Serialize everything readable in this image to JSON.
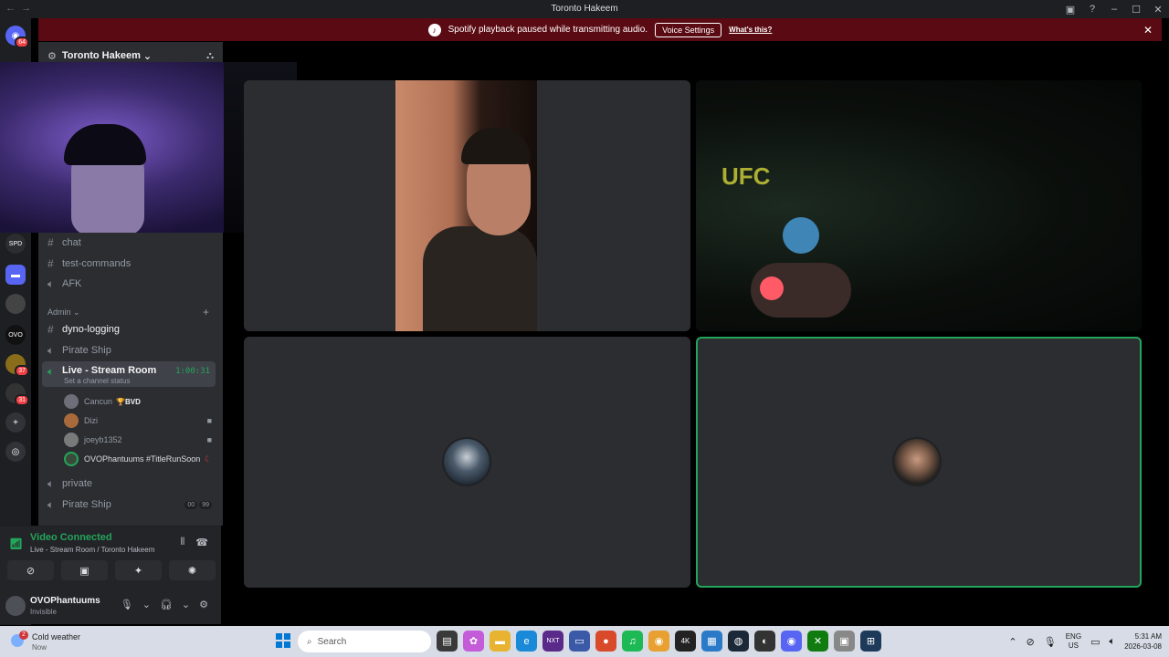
{
  "window": {
    "title": "Toronto Hakeem",
    "nav_back": "←",
    "nav_forward": "→",
    "controls": [
      "▣",
      "?",
      "–",
      "☐",
      "✕"
    ]
  },
  "banner": {
    "message": "Spotify playback paused while transmitting audio.",
    "button": "Voice Settings",
    "link": "What's this?",
    "close": "✕"
  },
  "server": {
    "name": "Toronto Hakeem",
    "rail": [
      {
        "icon": "discord-home-icon",
        "badge": "64"
      },
      {
        "icon": "server-icon",
        "badge": "37"
      },
      {
        "icon": "server-icon",
        "badge": "31"
      }
    ]
  },
  "channels": {
    "top": [
      {
        "name": "chat",
        "type": "text"
      },
      {
        "name": "test-commands",
        "type": "text"
      },
      {
        "name": "AFK",
        "type": "voice"
      }
    ],
    "admin_category": "Admin",
    "admin": [
      {
        "name": "dyno-logging",
        "type": "text"
      },
      {
        "name": "Pirate Ship",
        "type": "voice"
      }
    ],
    "live": {
      "name": "Live - Stream Room",
      "timer": "1:00:31",
      "status_hint": "Set a channel status"
    },
    "members": [
      {
        "name": "Cancun",
        "tag": "BVD"
      },
      {
        "name": "Dizi"
      },
      {
        "name": "joeyb1352"
      },
      {
        "name": "OVOPhantuums #TitleRunSoon"
      }
    ],
    "after": [
      {
        "name": "private",
        "type": "voice"
      },
      {
        "name": "Pirate Ship",
        "type": "voice",
        "pills": [
          "00",
          "99"
        ]
      }
    ]
  },
  "voice_panel": {
    "status": "Video Connected",
    "location": "Live - Stream Room / Toronto Hakeem",
    "buttons": [
      "camera-off-icon",
      "screen-share-icon",
      "activities-icon",
      "soundboard-icon"
    ]
  },
  "user": {
    "name": "OVOPhantuums",
    "status": "Invisible"
  },
  "taskbar": {
    "weather_badge": "2",
    "weather": "Cold weather",
    "weather_sub": "Now",
    "search": "Search",
    "lang_1": "ENG",
    "lang_2": "US",
    "time": "5:31 AM",
    "date": "2026-03-08"
  },
  "colors": {
    "banner": "#5a0a12",
    "connected": "#23a55a",
    "sidebar": "#2b2d31"
  }
}
